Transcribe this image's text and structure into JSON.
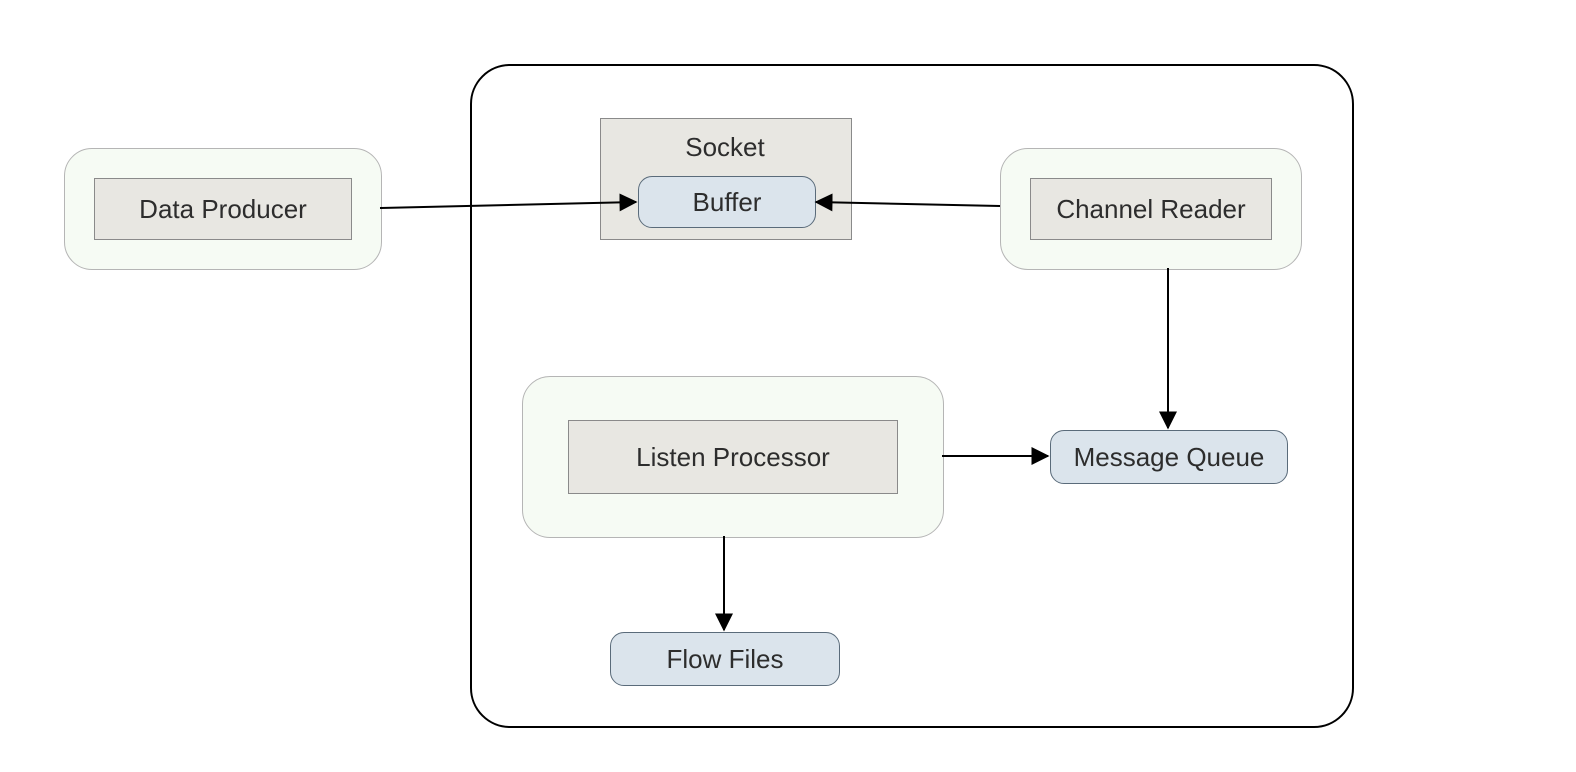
{
  "nodes": {
    "data_producer": "Data Producer",
    "socket_label": "Socket",
    "buffer": "Buffer",
    "channel_reader": "Channel  Reader",
    "listen_processor": "Listen Processor",
    "message_queue": "Message Queue",
    "flow_files": "Flow Files"
  },
  "edges": [
    {
      "from": "data_producer",
      "to": "buffer",
      "direction": "right"
    },
    {
      "from": "channel_reader",
      "to": "buffer",
      "direction": "left"
    },
    {
      "from": "channel_reader",
      "to": "message_queue",
      "direction": "down"
    },
    {
      "from": "listen_processor",
      "to": "message_queue",
      "direction": "right"
    },
    {
      "from": "listen_processor",
      "to": "flow_files",
      "direction": "down"
    }
  ],
  "layout": {
    "main_panel": "large rounded container on the right",
    "data_producer_position": "outside left, feeds into socket buffer"
  }
}
